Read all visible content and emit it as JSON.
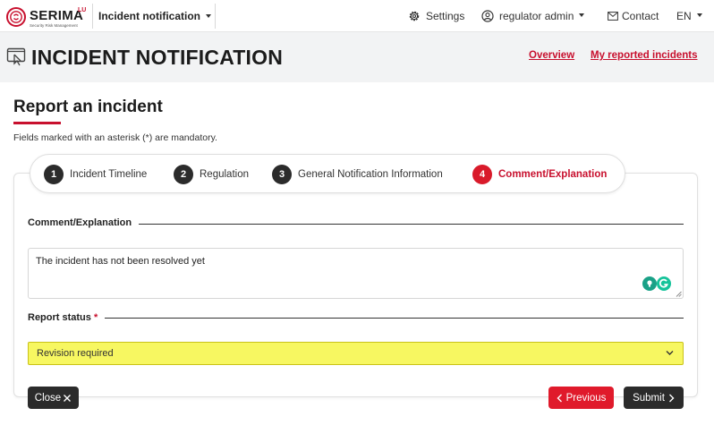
{
  "brand": {
    "name": "SERIMA",
    "sup": "LU",
    "tagline": "Security Risk Management",
    "accent": "#c8102e"
  },
  "topbar": {
    "app_switch": "Incident notification",
    "settings": "Settings",
    "user": "regulator admin",
    "contact": "Contact",
    "language": "EN"
  },
  "header": {
    "title": "INCIDENT NOTIFICATION",
    "overview_link": "Overview",
    "reported_link": "My reported incidents"
  },
  "section": {
    "title": "Report an incident",
    "mandatory_note": "Fields marked with an asterisk (*) are mandatory."
  },
  "steps": [
    {
      "num": "1",
      "label": "Incident Timeline"
    },
    {
      "num": "2",
      "label": "Regulation"
    },
    {
      "num": "3",
      "label": "General Notification Information"
    },
    {
      "num": "4",
      "label": "Comment/Explanation"
    }
  ],
  "active_step": 4,
  "comment": {
    "legend": "Comment/Explanation",
    "value": "The incident has not been resolved yet"
  },
  "report_status": {
    "legend": "Report status",
    "required_mark": "*",
    "selected": "Revision required",
    "highlight_color": "#f7f761"
  },
  "buttons": {
    "close": "Close",
    "previous": "Previous",
    "submit": "Submit"
  }
}
